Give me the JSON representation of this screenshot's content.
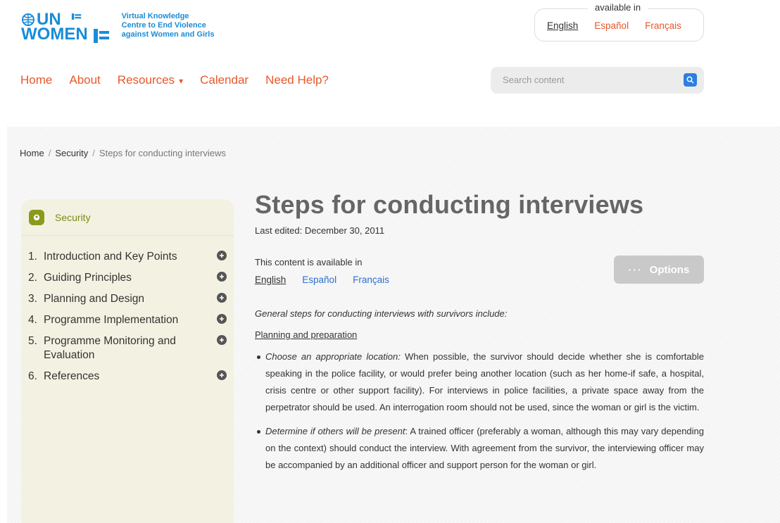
{
  "header": {
    "logo_un": "UN",
    "logo_women": "WOMEN",
    "logo_tagline": [
      "Virtual Knowledge",
      "Centre to End Violence",
      "against Women and Girls"
    ],
    "lang_caption": "available in",
    "languages": [
      "English",
      "Español",
      "Français"
    ]
  },
  "nav": {
    "items": [
      "Home",
      "About",
      "Resources",
      "Calendar",
      "Need Help?"
    ],
    "resources_caret": "▾"
  },
  "search": {
    "placeholder": "Search content"
  },
  "breadcrumb": {
    "items": [
      "Home",
      "Security"
    ],
    "separator": "/",
    "current": "Steps for conducting interviews"
  },
  "sidebar": {
    "title": "Security",
    "items": [
      {
        "num": "1.",
        "label": "Introduction and Key Points"
      },
      {
        "num": "2.",
        "label": "Guiding Principles"
      },
      {
        "num": "3.",
        "label": "Planning and Design"
      },
      {
        "num": "4.",
        "label": "Programme Implementation"
      },
      {
        "num": "5.",
        "label": "Programme Monitoring and",
        "label2": "Evaluation"
      },
      {
        "num": "6.",
        "label": "References"
      }
    ]
  },
  "article": {
    "title": "Steps for conducting interviews",
    "edited": "Last edited: December 30, 2011",
    "available_label": "This content is available in",
    "languages": [
      "English",
      "Español",
      "Français"
    ],
    "options_label": "Options",
    "options_dots": "···",
    "intro": "General steps for conducting interviews with survivors include:",
    "subhead": "Planning and preparation",
    "bullets": [
      {
        "lead": "Choose an appropriate location:",
        "text": " When possible, the survivor should decide whether she is comfortable speaking in the police facility, or would prefer being another location (such as her home-if safe, a hospital, crisis centre or other support facility). For interviews in police facilities, a private space away from the perpetrator should be used. An interrogation room should not be used, since the woman or girl is the victim."
      },
      {
        "lead": "Determine if others will be present",
        "text": ": A trained officer (preferably a woman, although this may vary depending on the context) should conduct the interview. With agreement from the survivor, the interviewing officer may be accompanied by an additional officer and support person for the woman or girl."
      }
    ]
  },
  "colors": {
    "accent_orange": "#e8582a",
    "brand_blue": "#1a8cd8",
    "link_blue": "#2c6fd0",
    "sidebar_bg": "#f3f2e2",
    "sidebar_accent": "#8a9a1a"
  }
}
